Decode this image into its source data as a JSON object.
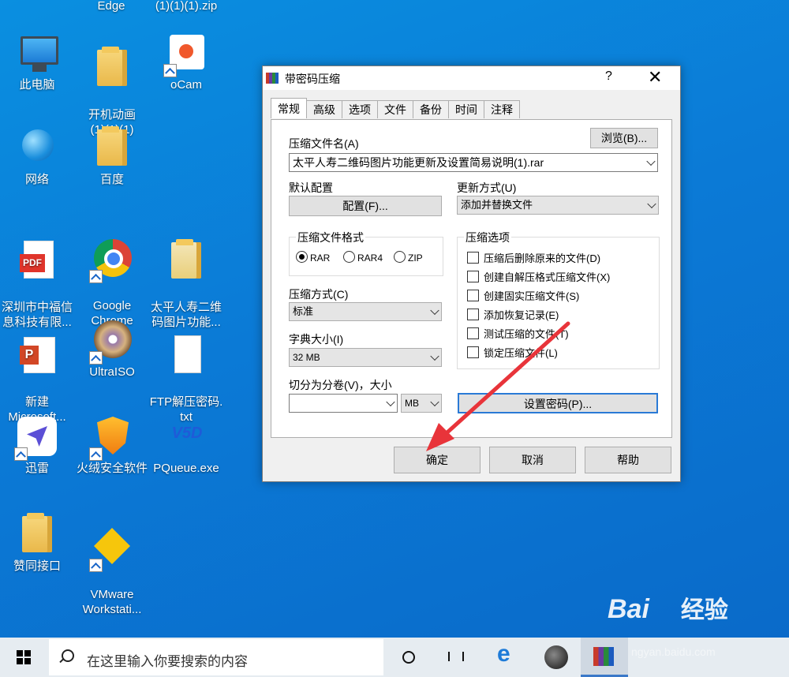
{
  "desktop": {
    "top_labels": [
      "Edge",
      "(1)(1)(1).zip"
    ],
    "icons": [
      {
        "label": "此电脑",
        "icon": "computer-icon"
      },
      {
        "label": "开机动画\n(1)(1)(1)",
        "icon": "folder-icon"
      },
      {
        "label": "oCam",
        "icon": "ocam-icon"
      },
      {
        "label": "网络",
        "icon": "network-icon"
      },
      {
        "label": "百度",
        "icon": "folder-icon"
      },
      {
        "label": "深圳市中福信\n息科技有限...",
        "icon": "pdf-icon"
      },
      {
        "label": "Google\nChrome",
        "icon": "chrome-icon"
      },
      {
        "label": "太平人寿二维\n码图片功能...",
        "icon": "document-icon"
      },
      {
        "label": "新建\nMicrosoft...",
        "icon": "powerpoint-icon"
      },
      {
        "label": "UltraISO",
        "icon": "disc-icon"
      },
      {
        "label": "FTP解压密码.\ntxt",
        "icon": "text-file-icon"
      },
      {
        "label": "迅雷",
        "icon": "thunder-icon"
      },
      {
        "label": "火绒安全软件",
        "icon": "shield-icon"
      },
      {
        "label": "PQueue.exe",
        "icon": "pqueue-icon"
      },
      {
        "label": "赞同接口",
        "icon": "folder-icon"
      },
      {
        "label": "VMware\nWorkstati...",
        "icon": "vmware-icon"
      }
    ]
  },
  "dialog": {
    "title": "带密码压缩",
    "help_glyph": "?",
    "close_glyph": "✕",
    "tabs": [
      "常规",
      "高级",
      "选项",
      "文件",
      "备份",
      "时间",
      "注释"
    ],
    "archive_name_label": "压缩文件名(A)",
    "browse_button": "浏览(B)...",
    "archive_name_value": "太平人寿二维码图片功能更新及设置简易说明(1).rar",
    "default_profile_label": "默认配置",
    "profile_button": "配置(F)...",
    "update_mode_label": "更新方式(U)",
    "update_mode_value": "添加并替换文件",
    "format_group_label": "压缩文件格式",
    "formats": [
      {
        "label": "RAR",
        "selected": true
      },
      {
        "label": "RAR4",
        "selected": false
      },
      {
        "label": "ZIP",
        "selected": false
      }
    ],
    "options_group_label": "压缩选项",
    "options": [
      {
        "label": "压缩后删除原来的文件(D)",
        "checked": false
      },
      {
        "label": "创建自解压格式压缩文件(X)",
        "checked": false
      },
      {
        "label": "创建固实压缩文件(S)",
        "checked": false
      },
      {
        "label": "添加恢复记录(E)",
        "checked": false
      },
      {
        "label": "测试压缩的文件(T)",
        "checked": false
      },
      {
        "label": "锁定压缩文件(L)",
        "checked": false
      }
    ],
    "method_label": "压缩方式(C)",
    "method_value": "标准",
    "dict_label": "字典大小(I)",
    "dict_value": "32 MB",
    "split_label": "切分为分卷(V)，大小",
    "split_value": "",
    "split_unit": "MB",
    "set_password_button": "设置密码(P)...",
    "ok_button": "确定",
    "cancel_button": "取消",
    "help_button": "帮助"
  },
  "annotation": {
    "color": "#e8343a"
  },
  "taskbar": {
    "search_placeholder": "在这里输入你要搜索的内容"
  },
  "watermark": {
    "brand": "Bai",
    "brand2": "经验",
    "sub": "ngyan.baidu.com"
  }
}
